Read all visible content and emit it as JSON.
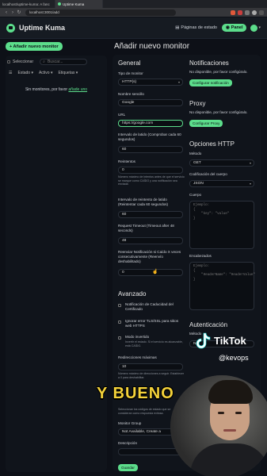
{
  "browser": {
    "tabs": [
      "localhost/uptime-kuma: A fanc",
      "Uptime Kuma"
    ],
    "url": "localhost:3001/add"
  },
  "header": {
    "app_title": "Uptime Kuma",
    "status_pages": "Páginas de estado",
    "panel_button": "Panel"
  },
  "left": {
    "add_monitor_button": "+ Añadir nuevo monitor",
    "select_label": "Seleccionar",
    "search_placeholder": "Buscar...",
    "filters": [
      "Estado",
      "Activo",
      "Etiquetas"
    ],
    "empty_text": "Sin monitores, por favor",
    "empty_link": "añade uno"
  },
  "main": {
    "page_title": "Añadir nuevo monitor",
    "general": {
      "heading": "General",
      "monitor_type_label": "Tipo de monitor",
      "monitor_type_value": "HTTP(s)",
      "friendly_name_label": "Nombre sencillo",
      "friendly_name_value": "Google",
      "url_label": "URL",
      "url_value": "https://google.com",
      "interval_label": "Intervalo de latido (Comprobar cada 60 segundos)",
      "interval_value": "60",
      "retries_label": "Reintentos",
      "retries_value": "0",
      "retries_hint": "Número máximo de intentos antes de que el servicio se marque como CAÍDO y una notificación sea enviada",
      "retry_interval_label": "Intervalo de reintento de latido (Reintentar cada 60 segundos)",
      "retry_interval_value": "60",
      "timeout_label": "Request Timeout (Timeout after 48 seconds)",
      "timeout_value": "48",
      "resend_label": "Reenviar Notificación si Caído X veces consecutivamente (Reenvío deshabilitado)",
      "resend_value": "0"
    },
    "advanced": {
      "heading": "Avanzado",
      "cert_expiry_label": "Notificación de Caducidad del Certificado",
      "ignore_tls_label": "Ignorar error TLS/SSL para sitios web HTTPS",
      "upside_down_label": "Modo invertido",
      "upside_down_hint": "Invertir el estado. Si el servicio es alcanzable, está CAÍDO.",
      "max_redirects_label": "Redirecciones máximas",
      "max_redirects_value": "10",
      "max_redirects_hint": "Número máximo de direcciones a seguir. Establecer a 0 para deshabilitar.",
      "status_codes_hint": "Seleccionar los códigos de estado que se consideran como respuesta exitosa.",
      "monitor_group_label": "Monitor Group",
      "monitor_group_value": "Not Available, Create a",
      "description_label": "Descripción",
      "save_button": "Guardar"
    },
    "notifications": {
      "heading": "Notificaciones",
      "not_available": "No disponible, por favor configúralo.",
      "setup_button": "Configurar notificación"
    },
    "proxy": {
      "heading": "Proxy",
      "not_available": "No disponible, por favor configúralo.",
      "setup_button": "Configurar Proxy"
    },
    "http_options": {
      "heading": "Opciones HTTP",
      "method_label": "Método",
      "method_value": "GET",
      "body_encoding_label": "Codificación del cuerpo",
      "body_encoding_value": "JSON",
      "body_label": "Cuerpo",
      "body_placeholder": "Ejemplo:\n{\n    \"key\": \"value\"\n}",
      "headers_label": "Encabezados",
      "headers_placeholder": "Ejemplo:\n{\n    \"HeaderName\": \"HeaderValue\"\n}"
    },
    "auth": {
      "heading": "Autenticación",
      "method_label": "Método",
      "method_value": "No"
    }
  },
  "overlay": {
    "tiktok_name": "TikTok",
    "tiktok_user": "@kevops",
    "caption": "Y BUENO"
  },
  "colors": {
    "accent": "#5cdd8b",
    "background": "#0d1017",
    "card": "#10141b",
    "caption": "#f4d23a"
  }
}
